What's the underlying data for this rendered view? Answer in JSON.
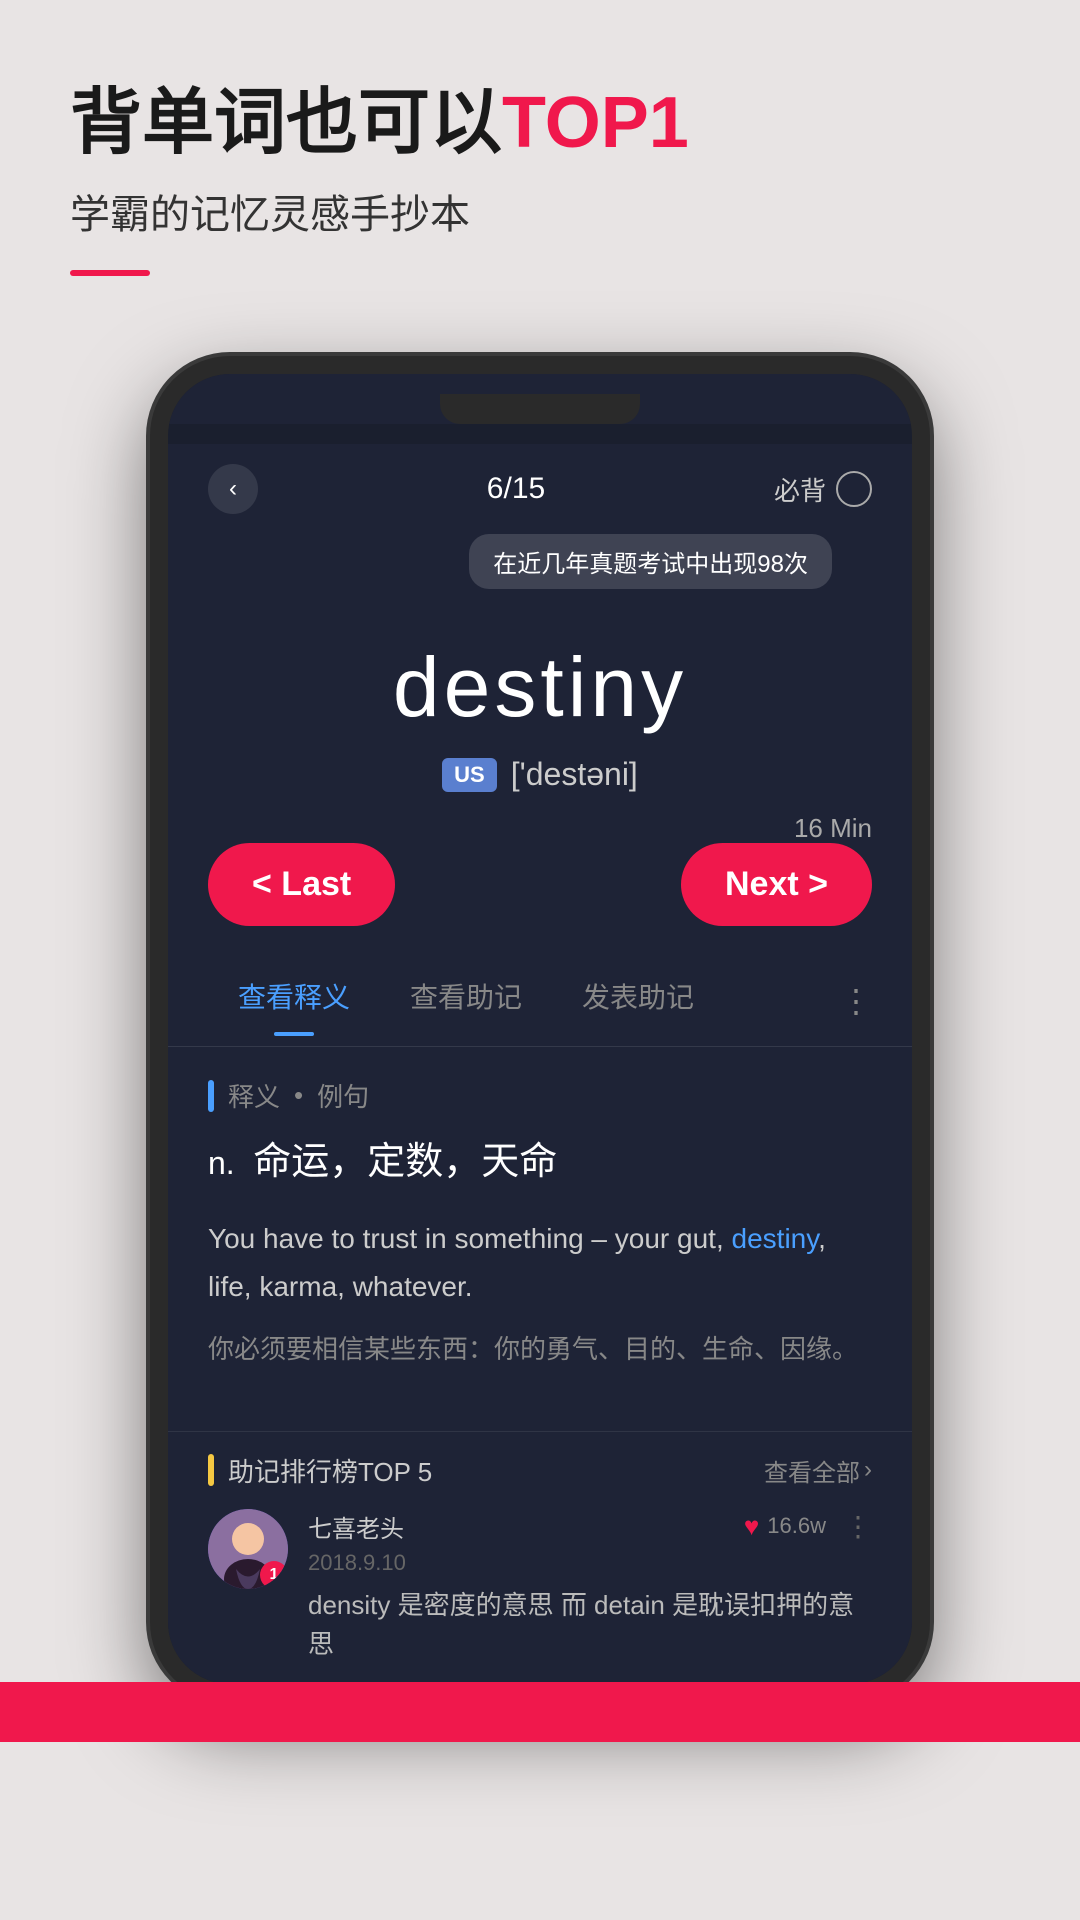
{
  "header": {
    "title_part1": "背单词也可以",
    "title_part2": "TOP1",
    "subtitle": "学霸的记忆灵感手抄本"
  },
  "phone": {
    "nav": {
      "back_icon": "‹",
      "progress": "6/15",
      "must_label": "必背"
    },
    "exam_badge": "在近几年真题考试中出现98次",
    "word": {
      "english": "destiny",
      "phonetic_tag": "US",
      "phonetic": "['destəni]"
    },
    "time": "16 Min",
    "buttons": {
      "last": "< Last",
      "next": "Next >"
    },
    "tabs": [
      {
        "label": "查看释义",
        "active": true
      },
      {
        "label": "查看助记",
        "active": false
      },
      {
        "label": "发表助记",
        "active": false
      }
    ],
    "tab_more_icon": "⋮",
    "definition": {
      "section_label": "释义",
      "section_dot": "•",
      "section_sub": "例句",
      "pos": "n.",
      "meaning": "命运，定数，天命",
      "example_en": "You have to trust in something – your gut, destiny, life, karma, whatever.",
      "example_keyword": "destiny",
      "example_cn": "你必须要相信某些东西：你的勇气、目的、生命、因缘。"
    },
    "mnemonic": {
      "section_label": "助记排行榜TOP 5",
      "view_all": "查看全部",
      "user": {
        "name": "七喜老头",
        "date": "2018.9.10",
        "badge": "1",
        "likes": "16.6w",
        "comment": "density 是密度的意思 而 detain 是耽误扣押的意思"
      }
    }
  }
}
